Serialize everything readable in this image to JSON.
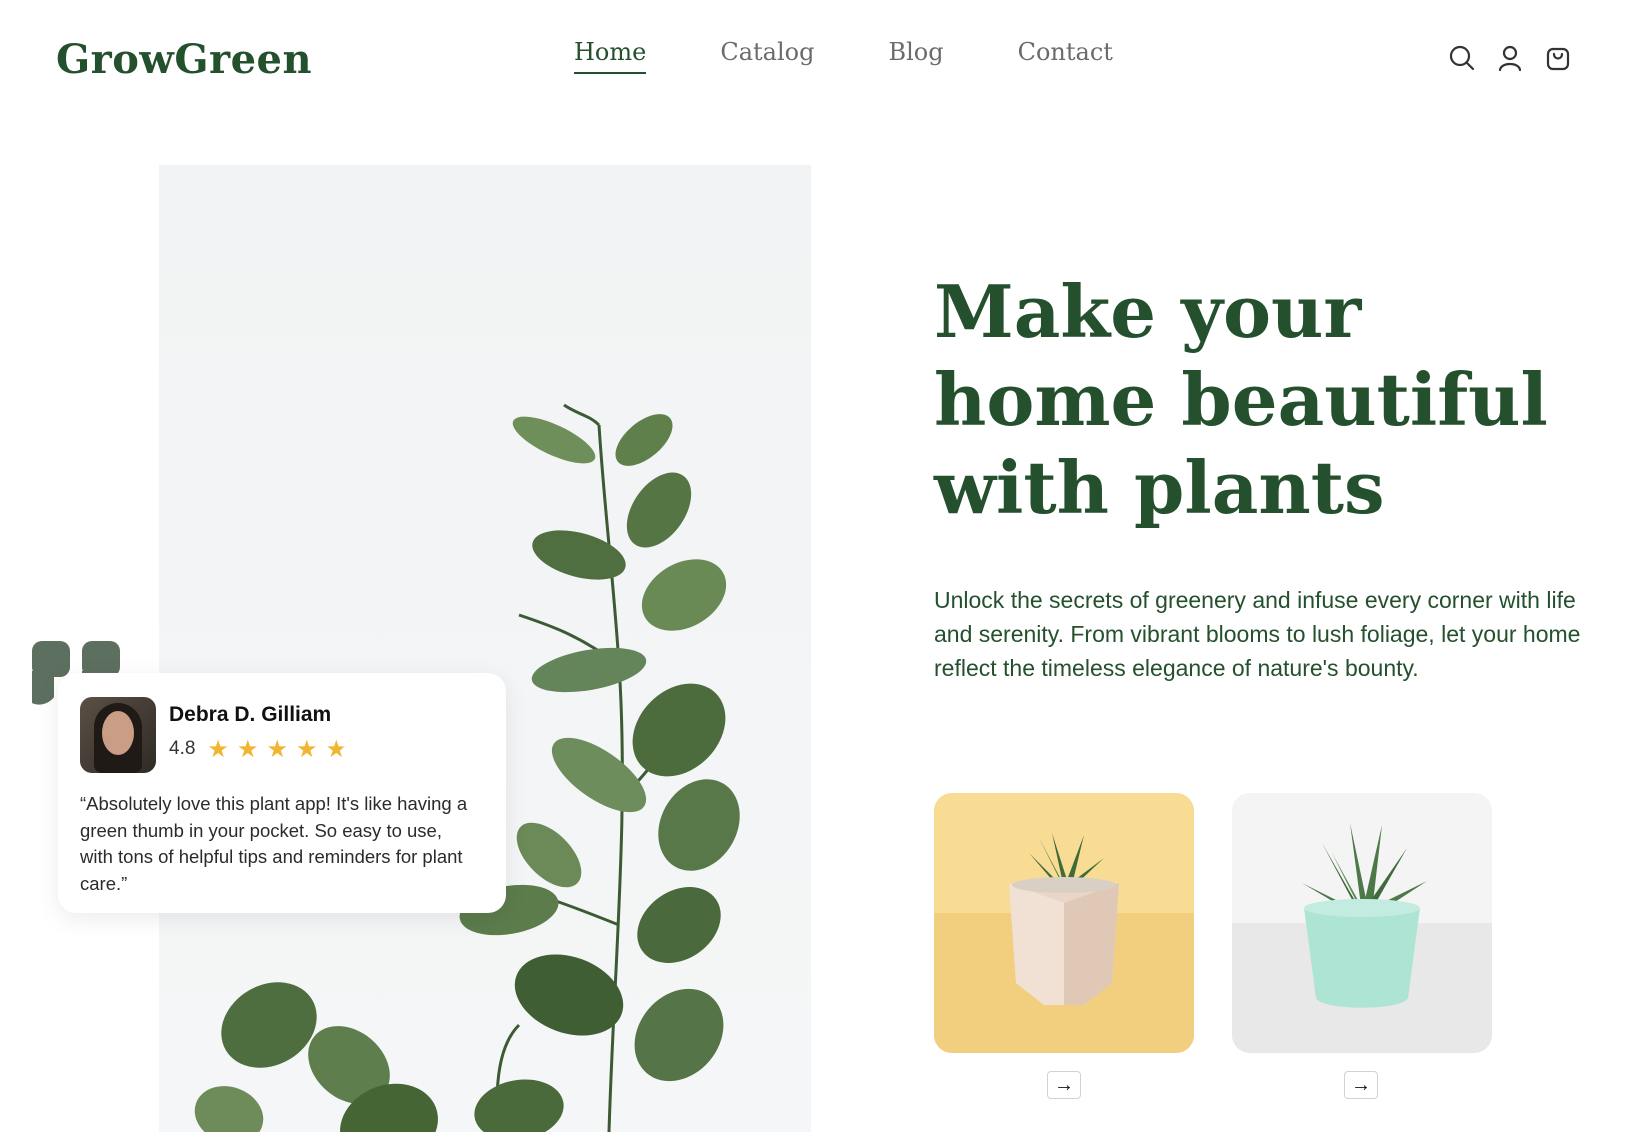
{
  "brand": {
    "logo": "GrowGreen"
  },
  "nav": {
    "items": [
      {
        "label": "Home",
        "active": true
      },
      {
        "label": "Catalog",
        "active": false
      },
      {
        "label": "Blog",
        "active": false
      },
      {
        "label": "Contact",
        "active": false
      }
    ]
  },
  "header_icons": [
    "search-icon",
    "user-icon",
    "shopping-bag-icon"
  ],
  "hero": {
    "headline": "Make your home beautiful with plants",
    "description": "Unlock the secrets of greenery and infuse every corner with life and serenity. From vibrant blooms to lush foliage, let your home reflect the timeless elegance of nature's bounty."
  },
  "review": {
    "name": "Debra D. Gilliam",
    "rating": "4.8",
    "stars": 4.8,
    "text": "“Absolutely love this plant app! It's like having a green thumb in your pocket. So easy to use, with tons of helpful tips and reminders for plant care.”"
  },
  "products": [
    {
      "icon": "succulent-wood-pot-image",
      "arrow": "→"
    },
    {
      "icon": "succulent-mint-pot-image",
      "arrow": "→"
    }
  ],
  "colors": {
    "brand_green": "#24502d",
    "star_yellow": "#f2b531",
    "quote_gray": "#5d7060"
  }
}
